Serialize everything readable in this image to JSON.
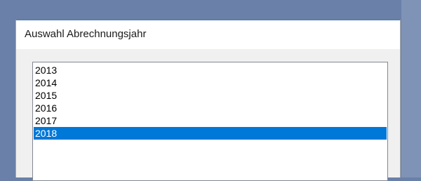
{
  "dialog": {
    "title": "Auswahl Abrechnungsjahr",
    "accent_color": "#0078d7"
  },
  "year_list": {
    "items": [
      {
        "label": "2013",
        "selected": false
      },
      {
        "label": "2014",
        "selected": false
      },
      {
        "label": "2015",
        "selected": false
      },
      {
        "label": "2016",
        "selected": false
      },
      {
        "label": "2017",
        "selected": false
      },
      {
        "label": "2018",
        "selected": true
      }
    ]
  }
}
